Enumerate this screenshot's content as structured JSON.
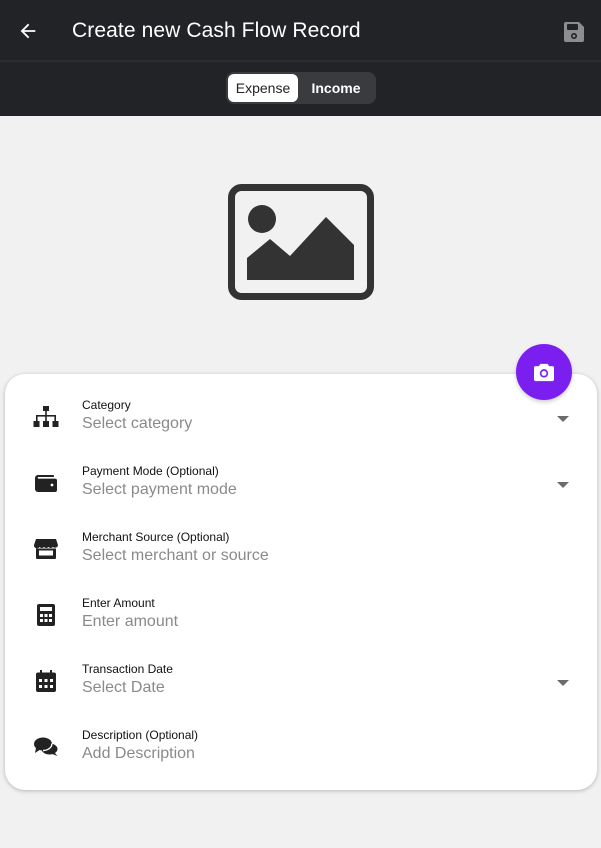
{
  "appbar": {
    "title": "Create new Cash Flow Record",
    "back_icon": "arrow-left-icon",
    "save_icon": "floppy-disk-icon"
  },
  "toggle": {
    "options": [
      "Expense",
      "Income"
    ],
    "selected": "Expense"
  },
  "image_placeholder_icon": "image-placeholder-icon",
  "fab_icon": "camera-icon",
  "colors": {
    "appbar_bg": "#222326",
    "accent": "#7b1ff1",
    "page_bg": "#f1f1f1"
  },
  "fields": [
    {
      "label": "Category",
      "placeholder": "Select category",
      "icon": "sitemap-icon",
      "dropdown": true
    },
    {
      "label": "Payment Mode (Optional)",
      "placeholder": "Select payment mode",
      "icon": "wallet-icon",
      "dropdown": true
    },
    {
      "label": "Merchant Source (Optional)",
      "placeholder": "Select merchant or source",
      "icon": "store-icon",
      "dropdown": false
    },
    {
      "label": "Enter Amount",
      "placeholder": "Enter amount",
      "icon": "calculator-icon",
      "dropdown": false
    },
    {
      "label": "Transaction Date",
      "placeholder": "Select Date",
      "icon": "calendar-icon",
      "dropdown": true
    },
    {
      "label": "Description (Optional)",
      "placeholder": "Add Description",
      "icon": "comments-icon",
      "dropdown": false
    }
  ]
}
